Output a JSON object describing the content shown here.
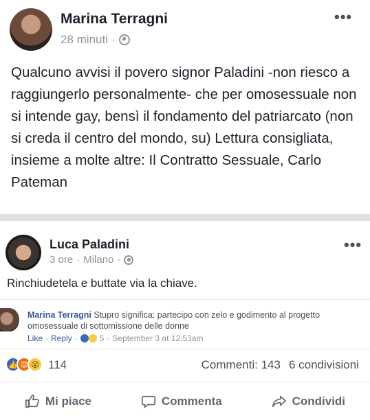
{
  "post": {
    "author": "Marina Terragni",
    "time": "28 minuti",
    "separator": "·",
    "text": "Qualcuno avvisi il povero signor Paladini -non riesco a raggiungerlo personalmente- che per omosessuale non si intende gay, bensì il fondamento del patriarcato (non si creda il centro del mondo, su) Lettura consigliata, insieme a molte altre: Il Contratto Sessuale, Carlo Pateman",
    "more": "•••"
  },
  "shared_post": {
    "author": "Luca Paladini",
    "time": "3 ore",
    "separator": "·",
    "location": "Milano",
    "separator2": "·",
    "text": "Rinchiudetela e buttate via la chiave.",
    "more": "•••"
  },
  "comment": {
    "author": "Marina Terragni",
    "text": "Stupro significa: partecipo con zelo e godimento al progetto omosessuale di sottomissione delle donne",
    "like": "Like",
    "reply": "Reply",
    "reaction_count": "5",
    "date": "September 3 at 12:53am",
    "dot": "·"
  },
  "reactions": {
    "count": "114",
    "comments": "Commenti: 143",
    "shares": "6 condivisioni"
  },
  "actions": {
    "like": "Mi piace",
    "comment": "Commenta",
    "share": "Condividi"
  }
}
